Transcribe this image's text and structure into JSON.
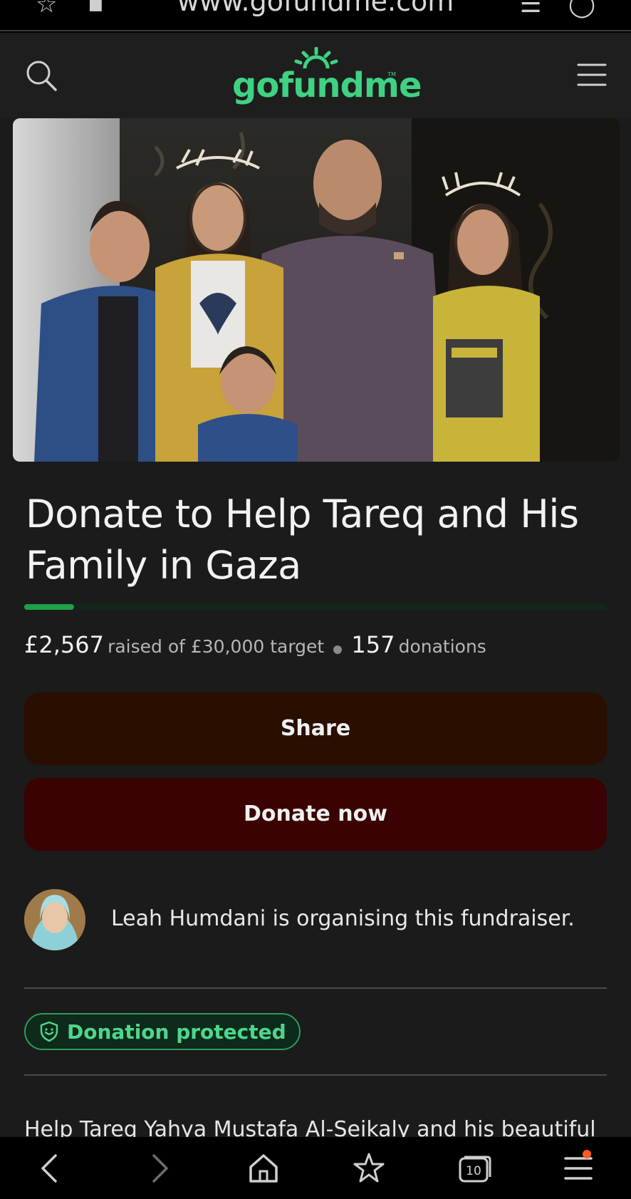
{
  "browser": {
    "url": "www.gofundme.com"
  },
  "header": {
    "logo_text": "gofundme",
    "logo_tm": "TM"
  },
  "campaign": {
    "title": "Donate to Help Tareq and His Family in Gaza",
    "progress_fraction": 0.0856,
    "raised": "£2,567",
    "raised_suffix": "raised of £30,000 target",
    "donation_count": "157",
    "donation_suffix": "donations",
    "share_label": "Share",
    "donate_label": "Donate now",
    "organiser_text": "Leah Humdani is organising this fundraiser.",
    "protected_label": "Donation protected",
    "story_start": "Help Tareq Yahya Mustafa Al-Seikaly and his beautiful"
  },
  "colors": {
    "brand_green": "#3fd282",
    "share_bg": "#2a0e00",
    "donate_bg": "#3a0202",
    "progress": "#1fa04a",
    "notification": "#ff5a1f"
  },
  "icons": {
    "top_left": [
      "bookmark-icon",
      "lock-icon"
    ],
    "top_right": [
      "menu-icon",
      "profile-icon"
    ],
    "header": [
      "search-icon",
      "hamburger-menu-icon"
    ],
    "bottom_nav": [
      "back-icon",
      "forward-icon",
      "home-icon",
      "bookmarks-icon",
      "tabs-icon",
      "menu-icon"
    ]
  },
  "tabs_count": "10"
}
